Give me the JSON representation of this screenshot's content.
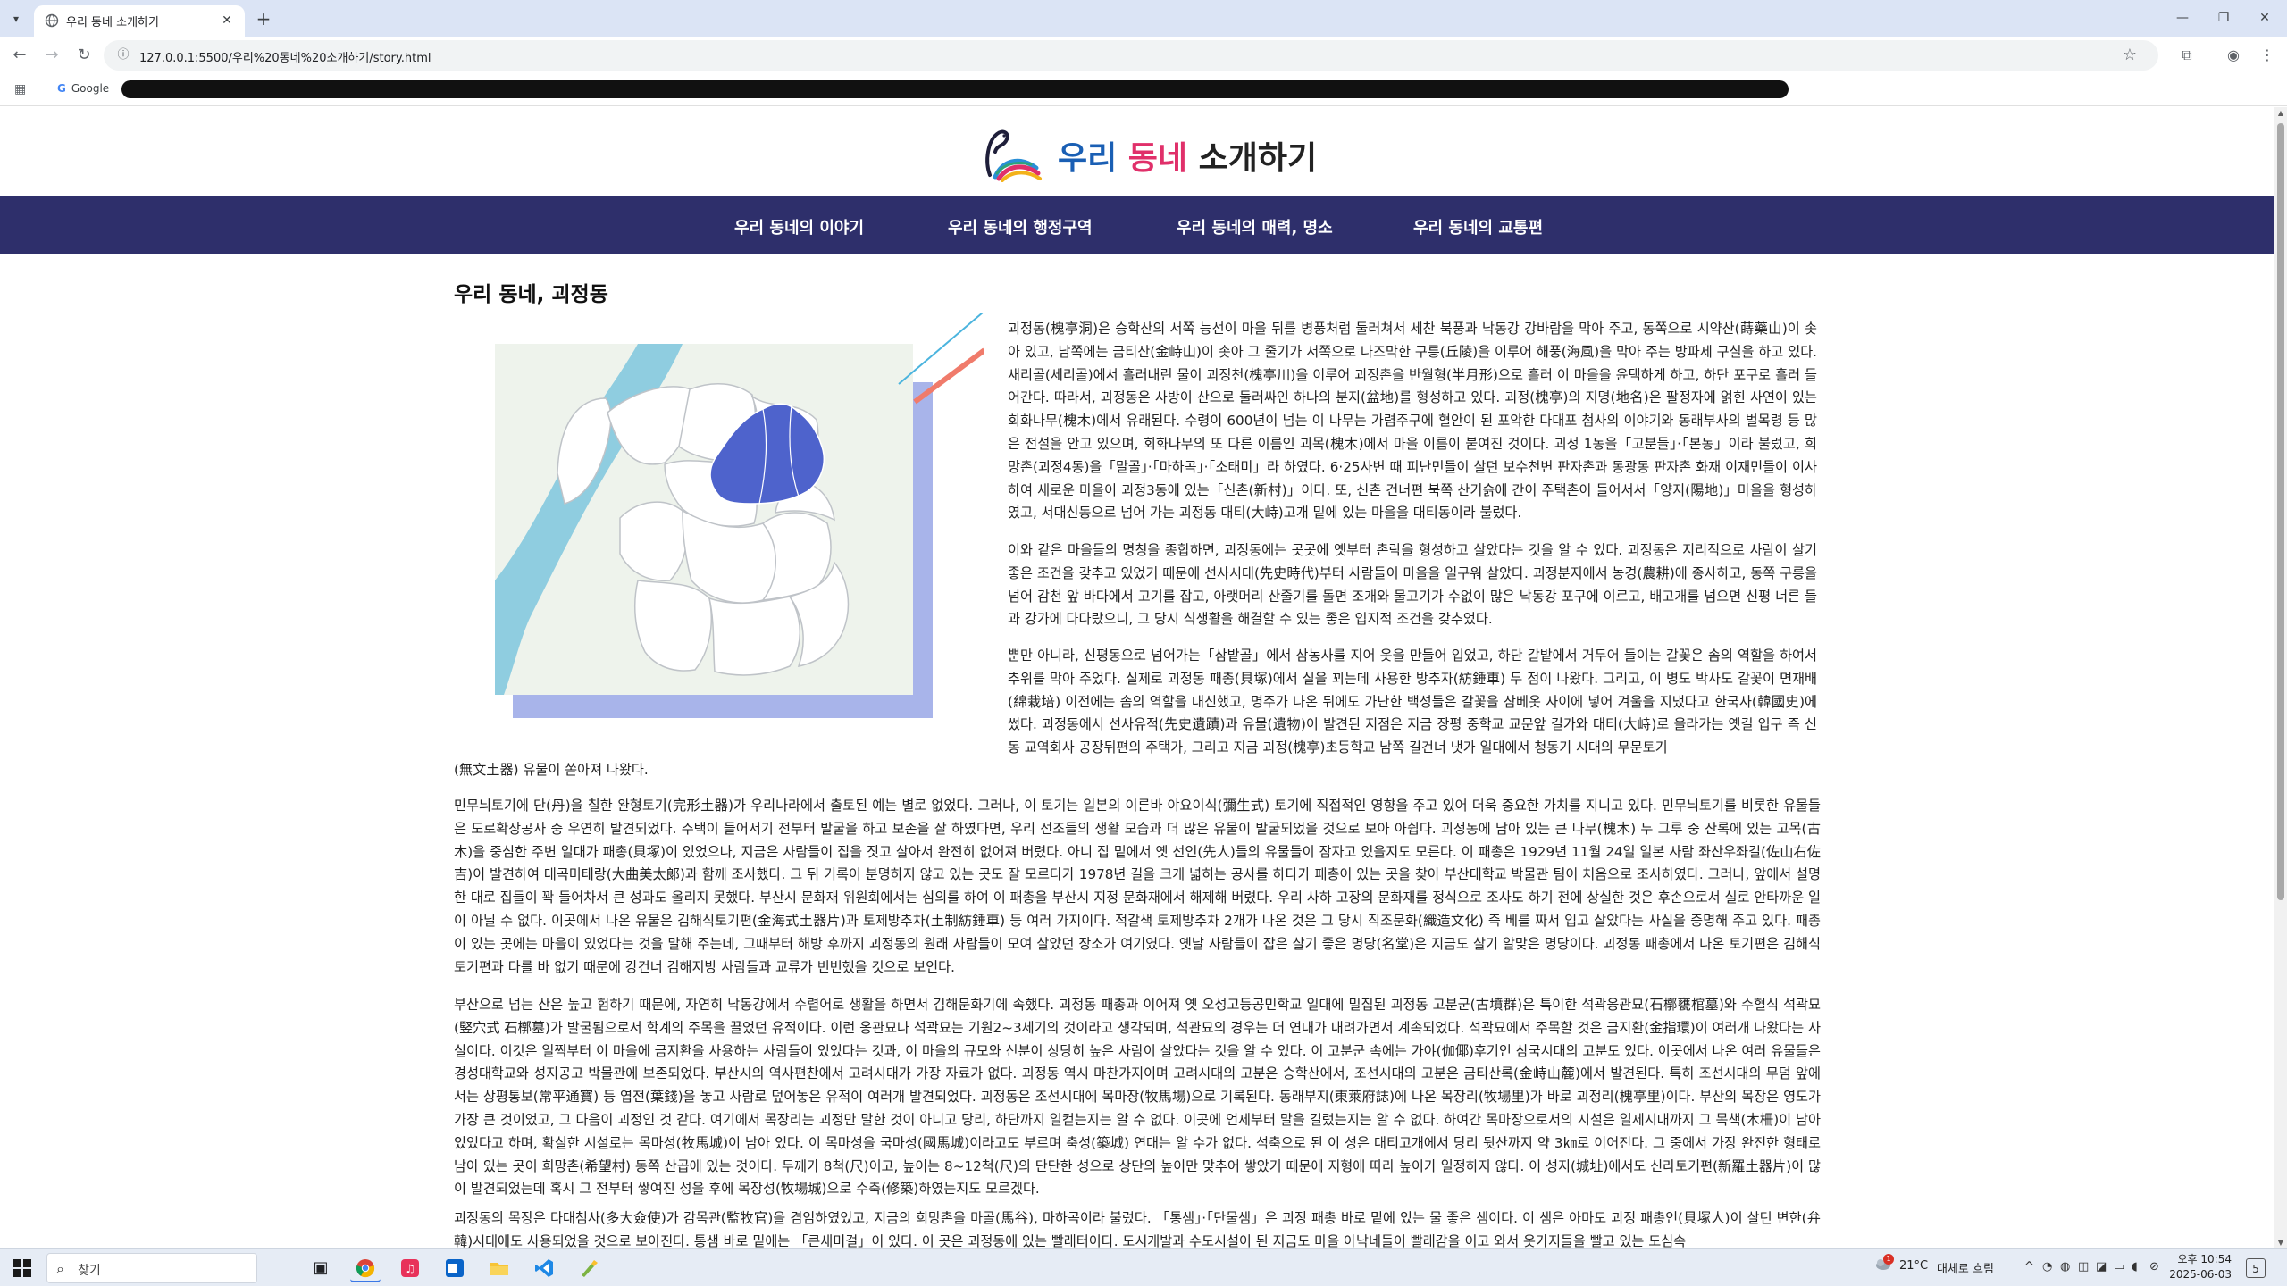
{
  "browser": {
    "tab_title": "우리 동네 소개하기",
    "tab_favicon": "globe-icon",
    "url": "127.0.0.1:5500/우리%20동네%20소개하기/story.html",
    "bookmark_google": "Google"
  },
  "site": {
    "title_part1": "우리",
    "title_part2": "동네",
    "title_part3": "소개하기",
    "title_colors": {
      "part1": "#1a5fb4",
      "part2": "#e0306a",
      "part3": "#222222"
    },
    "nav_bg": "#2e2f6b",
    "nav": [
      {
        "label": "우리 동네의 이야기"
      },
      {
        "label": "우리 동네의 행정구역"
      },
      {
        "label": "우리 동네의 매력, 명소"
      },
      {
        "label": "우리 동네의 교통편"
      }
    ]
  },
  "article": {
    "heading": "우리 동네, 괴정동",
    "p1": "괴정동(槐亭洞)은 승학산의 서쪽 능선이 마을 뒤를 병풍처럼 둘러쳐서 세찬 북풍과 낙동강 강바람을 막아 주고, 동쪽으로 시약산(蒔藥山)이 솟아 있고, 남쪽에는 금티산(金峙山)이 솟아 그 줄기가 서쪽으로 나즈막한 구릉(丘陵)을 이루어 해풍(海風)을 막아 주는 방파제 구실을 하고 있다. 새리골(세리골)에서 흘러내린 물이 괴정천(槐亭川)을 이루어 괴정촌을 반월형(半月形)으로 흘러 이 마을을 윤택하게 하고, 하단 포구로 흘러 들어간다. 따라서, 괴정동은 사방이 산으로 둘러싸인 하나의 분지(盆地)를 형성하고 있다. 괴정(槐亭)의 지명(地名)은 팔정자에 얽힌 사연이 있는 회화나무(槐木)에서 유래된다. 수령이 600년이 넘는 이 나무는 가렴주구에 혈안이 된 포악한 다대포 첨사의 이야기와 동래부사의 벌목령 등 많은 전설을 안고 있으며, 회화나무의 또 다른 이름인 괴목(槐木)에서 마을 이름이 붙여진 것이다. 괴정 1동을「고분들」·「본동」이라 불렀고, 희망촌(괴정4동)을「말골」·「마하곡」·「소태미」라 하였다. 6·25사변 때 피난민들이 살던 보수천변 판자촌과 동광동 판자촌 화재 이재민들이 이사하여 새로운 마을이 괴정3동에 있는「신촌(新村)」이다. 또, 신촌 건너편 북쪽 산기슭에 간이 주택촌이 들어서서「양지(陽地)」마을을 형성하였고, 서대신동으로 넘어 가는 괴정동 대티(大峙)고개 밑에 있는 마을을 대티동이라 불렀다.",
    "p2": "이와 같은 마을들의 명칭을 종합하면, 괴정동에는 곳곳에 옛부터 촌락을 형성하고 살았다는 것을 알 수 있다. 괴정동은 지리적으로 사람이 살기 좋은 조건을 갖추고 있었기 때문에 선사시대(先史時代)부터 사람들이 마을을 일구워 살았다. 괴정분지에서 농경(農耕)에 종사하고, 동쪽 구릉을 넘어 감천 앞 바다에서 고기를 잡고, 아랫머리 산줄기를 돌면 조개와 물고기가 수없이 많은 낙동강 포구에 이르고, 배고개를 넘으면 신평 너른 들과 강가에 다다랐으니, 그 당시 식생활을 해결할 수 있는 좋은 입지적 조건을 갖추었다.",
    "p3": "뿐만 아니라, 신평동으로 넘어가는「삼밭골」에서 삼농사를 지어 옷을 만들어 입었고, 하단 갈밭에서 거두어 들이는 갈꽃은 솜의 역할을 하여서 추위를 막아 주었다. 실제로 괴정동 패총(貝塚)에서 실을 꾀는데 사용한 방추자(紡錘車) 두 점이 나왔다. 그리고, 이 병도 박사도 갈꽃이 면재배(綿栽培) 이전에는 솜의 역할을 대신했고, 명주가 나온 뒤에도 가난한 백성들은 갈꽃을 삼베옷 사이에 넣어 겨울을 지냈다고 한국사(韓國史)에 썼다. 괴정동에서 선사유적(先史遺蹟)과 유물(遺物)이 발견된 지점은 지금 장평 중학교 교문앞 길가와 대티(大峙)로 올라가는 옛길 입구 즉 신동 교역회사 공장뒤편의 주택가, 그리고 지금 괴정(槐亭)초등학교 남쪽 길건너 냇가 일대에서 청동기 시대의 무문토기",
    "p3_tail": "(無文土器) 유물이 쏟아져 나왔다.",
    "p4": "민무늬토기에 단(丹)을 칠한 완형토기(完形土器)가 우리나라에서 출토된 예는 별로 없었다. 그러나, 이 토기는 일본의 이른바 야요이식(彌生式) 토기에 직접적인 영향을 주고 있어 더욱 중요한 가치를 지니고 있다. 민무늬토기를 비롯한 유물들은 도로확장공사 중 우연히 발견되었다. 주택이 들어서기 전부터 발굴을 하고 보존을 잘 하였다면, 우리 선조들의 생활 모습과 더 많은 유물이 발굴되었을 것으로 보아 아쉽다. 괴정동에 남아 있는 큰 나무(槐木) 두 그루 중 산록에 있는 고목(古木)을 중심한 주변 일대가 패총(貝塚)이 있었으나, 지금은 사람들이 집을 짓고 살아서 완전히 없어져 버렸다. 아니 집 밑에서 옛 선인(先人)들의 유물들이 잠자고 있을지도 모른다. 이 패총은 1929년 11월 24일 일본 사람 좌산우좌길(佐山右佐吉)이 발견하여 대곡미태랑(大曲美太郞)과 함께 조사했다. 그 뒤 기록이 분명하지 않고 있는 곳도 잘 모르다가 1978년 길을 크게 넓히는 공사를 하다가 패총이 있는 곳을 찾아 부산대학교 박물관 팀이 처음으로 조사하였다. 그러나, 앞에서 설명한 대로 집들이 꽉 들어차서 큰 성과도 올리지 못했다. 부산시 문화재 위원회에서는 심의를 하여 이 패총을 부산시 지정 문화재에서 해제해 버렸다. 우리 사하 고장의 문화재를 정식으로 조사도 하기 전에 상실한 것은 후손으로서 실로 안타까운 일이 아닐 수 없다. 이곳에서 나온 유물은 김해식토기편(金海式土器片)과 토제방추차(土制紡錘車) 등 여러 가지이다. 적갈색 토제방추차 2개가 나온 것은 그 당시 직조문화(織造文化) 즉 베를 짜서 입고 살았다는 사실을 증명해 주고 있다. 패총이 있는 곳에는 마을이 있었다는 것을 말해 주는데, 그때부터 해방 후까지 괴정동의 원래 사람들이 모여 살았던 장소가 여기였다. 옛날 사람들이 잡은 살기 좋은 명당(名堂)은 지금도 살기 알맞은 명당이다. 괴정동 패총에서 나온 토기편은 김해식 토기편과 다를 바 없기 때문에 강건너 김해지방 사람들과 교류가 빈번했을 것으로 보인다.",
    "p5": "부산으로 넘는 산은 높고 험하기 때문에, 자연히 낙동강에서 수렵어로 생활을 하면서 김해문화기에 속했다. 괴정동 패총과 이어져 옛 오성고등공민학교 일대에 밀집된 괴정동 고분군(古墳群)은 특이한 석곽옹관묘(石槨甕棺墓)와 수혈식 석곽묘(竪穴式 石槨墓)가 발굴됨으로서 학계의 주목을 끌었던 유적이다. 이런 옹관묘나 석곽묘는 기원2~3세기의 것이라고 생각되며, 석관묘의 경우는 더 연대가 내려가면서 계속되었다. 석곽묘에서 주목할 것은 금지환(金指環)이 여러개 나왔다는 사실이다. 이것은 일찍부터 이 마을에 금지환을 사용하는 사람들이 있었다는 것과, 이 마을의 규모와 신분이 상당히 높은 사람이 살았다는 것을 알 수 있다. 이 고분군 속에는 가야(伽倻)후기인 삼국시대의 고분도 있다. 이곳에서 나온 여러 유물들은 경성대학교와 성지공고 박물관에 보존되었다. 부산시의 역사편찬에서 고려시대가 가장 자료가 없다. 괴정동 역시 마찬가지이며 고려시대의 고분은 승학산에서, 조선시대의 고분은 금티산록(金峙山麓)에서 발견된다. 특히 조선시대의 무덤 앞에서는 상평통보(常平通寶) 등 엽전(葉錢)을 놓고 사람로 덮어놓은 유적이 여러개 발견되었다. 괴정동은 조선시대에 목마장(牧馬場)으로 기록된다. 동래부지(東萊府誌)에 나온 목장리(牧場里)가 바로 괴정리(槐亭里)이다. 부산의 목장은 영도가 가장 큰 것이었고, 그 다음이 괴정인 것 같다. 여기에서 목장리는 괴정만 말한 것이 아니고 당리, 하단까지 일컫는지는 알 수 없다. 이곳에 언제부터 말을 길렀는지는 알 수 없다. 하여간 목마장으로서의 시설은 일제시대까지 그 목책(木柵)이 남아 있었다고 하며, 확실한 시설로는 목마성(牧馬城)이 남아 있다. 이 목마성을 국마성(國馬城)이라고도 부르며 축성(築城) 연대는 알 수가 없다. 석축으로 된 이 성은 대티고개에서 당리 뒷산까지 약 3㎞로 이어진다. 그 중에서 가장 완전한 형태로 남아 있는 곳이 희망촌(希望村) 동쪽 산곱에 있는 것이다. 두께가 8척(尺)이고, 높이는 8~12척(尺)의 단단한 성으로 상단의 높이만 맞추어 쌓았기 때문에 지형에 따라 높이가 일정하지 않다. 이 성지(城址)에서도 신라토기편(新羅土器片)이 많이 발견되었는데 혹시 그 전부터 쌓여진 성을 후에 목장성(牧場城)으로 수축(修築)하였는지도 모르겠다.",
    "p6": "괴정동의 목장은 다대첨사(多大僉使)가 감목관(監牧官)을 겸임하였었고, 지금의 희망촌을 마골(馬谷), 마하곡이라 불렀다. 「통샘」·「단물샘」은 괴정 패총 바로 밑에 있는 물 좋은 샘이다. 이 샘은 아마도 괴정 패총인(貝塚人)이 살던 변한(弁韓)시대에도 사용되었을 것으로 보아진다. 통샘 바로 밑에는 「큰새미걸」이 있다. 이 곳은 괴정동에 있는 빨래터이다. 도시개발과 수도시설이 된 지금도 마을 아낙네들이 빨래감을 이고 와서 옷가지들을 빨고 있는 도심속"
  },
  "taskbar": {
    "search_placeholder": "찾기",
    "weather_temp": "21°C",
    "weather_desc": "대체로 흐림",
    "weather_badge": "1",
    "clock_time": "오후 10:54",
    "clock_date": "2025-06-03",
    "notif_count": "5"
  }
}
